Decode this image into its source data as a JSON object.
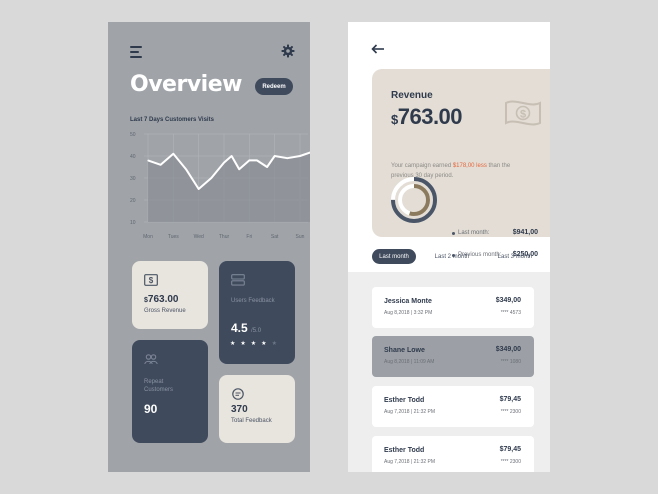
{
  "overview": {
    "title": "Overview",
    "redeem_label": "Redeem",
    "chart_caption": "Last 7 Days Customers Visits"
  },
  "chart_data": {
    "type": "line",
    "title": "Last 7 Days Customers Visits",
    "categories": [
      "Mon",
      "Tues",
      "Wed",
      "Thur",
      "Fri",
      "Sat",
      "Sun"
    ],
    "x": [
      0,
      0.5,
      1,
      1.5,
      2,
      2.5,
      3,
      3.3,
      3.6,
      4,
      4.3,
      4.7,
      5,
      5.5,
      6,
      6.5
    ],
    "y": [
      38,
      36,
      41,
      34,
      25,
      30,
      37,
      40,
      34,
      38,
      38,
      35,
      40,
      39,
      40,
      42
    ],
    "y_ticks": [
      50,
      40,
      30,
      20,
      10
    ],
    "ylim": [
      10,
      50
    ],
    "grid": true,
    "colors": {
      "line": "#ffffff",
      "area": "#8b8f95",
      "grid": "#b4b8bd"
    }
  },
  "cards": {
    "gross": {
      "currency": "$",
      "value": "763.00",
      "label": "Gross Revenue"
    },
    "feedback": {
      "label": "Users Feedback",
      "score": "4.5",
      "scale": "/5.0",
      "stars_filled": 4,
      "stars_total": 5
    },
    "repeat": {
      "label": "Repeat Customers",
      "value": "90"
    },
    "total": {
      "value": "370",
      "label": "Total Feedback"
    }
  },
  "revenue": {
    "title": "Revenue",
    "currency": "$",
    "amount": "763.00",
    "note_prefix": "Your campaign earned",
    "note_diff": "$178,00 less",
    "note_suffix": "than the previous 30 day period.",
    "stats": [
      {
        "label": "Last month:",
        "value": "$941,00"
      },
      {
        "label": "Previous month:",
        "value": "$250,00"
      }
    ],
    "donut": {
      "outer_share": 0.75,
      "inner_share": 0.55,
      "outer_color": "#4a5668",
      "inner_color": "#8c7a5e"
    }
  },
  "tabs": [
    "Last month",
    "Last 2 month",
    "Last 3 month"
  ],
  "transactions": [
    {
      "name": "Jessica Monte",
      "date": "Aug 8,2018  |  3:32 PM",
      "amount": "$349,00",
      "card": "**** 4573"
    },
    {
      "name": "Shane Lowe",
      "date": "Aug 8,2018  |  11:09 AM",
      "amount": "$349,00",
      "card": "**** 1080"
    },
    {
      "name": "Esther Todd",
      "date": "Aug 7,2018  |  21:32 PM",
      "amount": "$79,45",
      "card": "**** 2300"
    },
    {
      "name": "Esther Todd",
      "date": "Aug 7,2018  |  21:32 PM",
      "amount": "$79,45",
      "card": "**** 2300"
    }
  ],
  "colors": {
    "navy": "#3f4a5c",
    "beige": "#e8e4de",
    "accent_orange": "#e3683d",
    "left_bg": "#a0a4a9"
  }
}
